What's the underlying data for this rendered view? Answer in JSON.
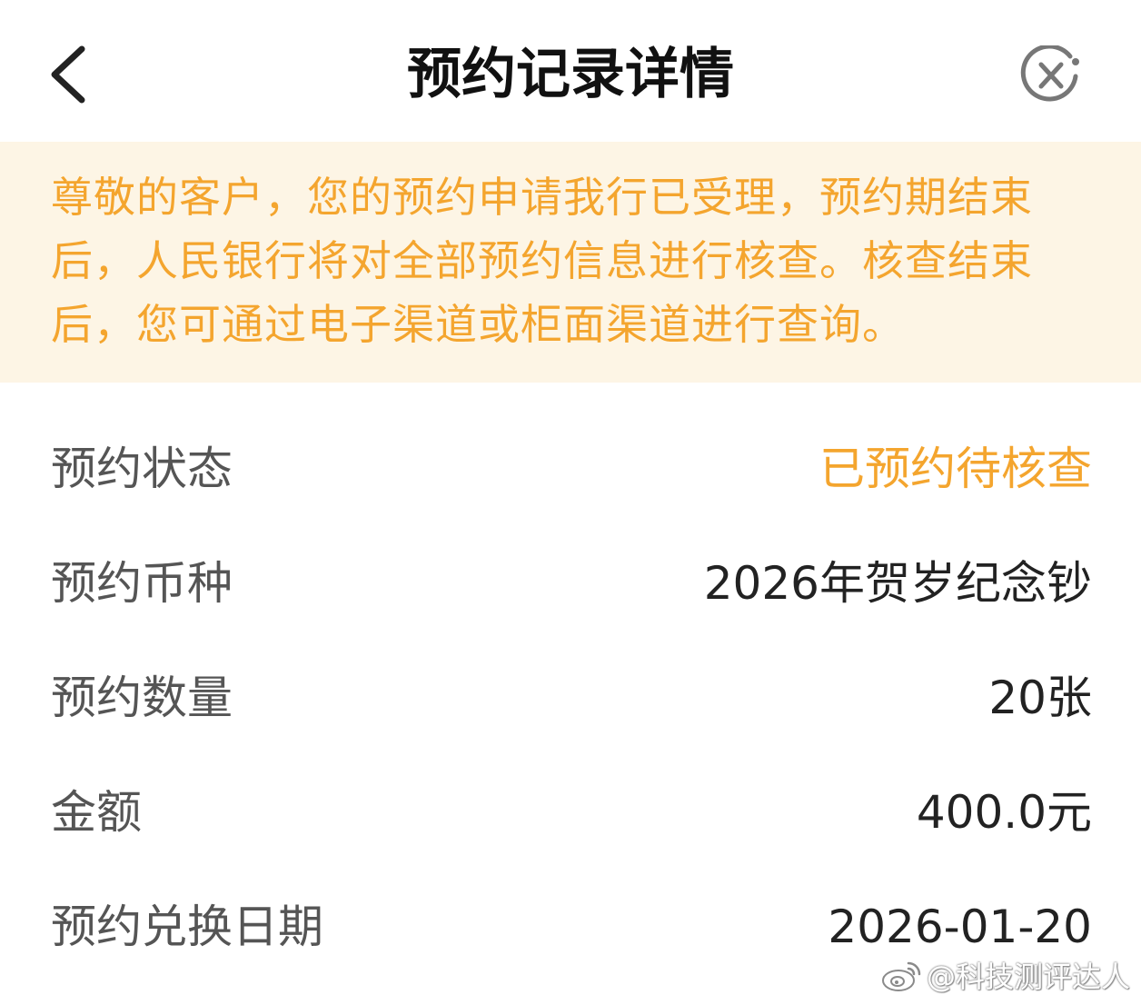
{
  "header": {
    "title": "预约记录详情",
    "back_icon": "chevron-left-icon",
    "close_icon": "close-circle-icon"
  },
  "notice": {
    "text": "尊敬的客户，您的预约申请我行已受理，预约期结束后，人民银行将对全部预约信息进行核查。核查结束后，您可通过电子渠道或柜面渠道进行查询。",
    "text_color": "#f4a52e",
    "background_color": "#fdf5e5"
  },
  "details": [
    {
      "label": "预约状态",
      "value": "已预约待核查"
    },
    {
      "label": "预约币种",
      "value": "2026年贺岁纪念钞"
    },
    {
      "label": "预约数量",
      "value": "20张"
    },
    {
      "label": "金额",
      "value": "400.0元"
    },
    {
      "label": "预约兑换日期",
      "value": "2026-01-20"
    }
  ],
  "watermark": {
    "icon": "weibo-icon",
    "text": "@科技测评达人"
  },
  "colors": {
    "accent": "#f4a52e",
    "label": "#555555",
    "value": "#222222"
  }
}
